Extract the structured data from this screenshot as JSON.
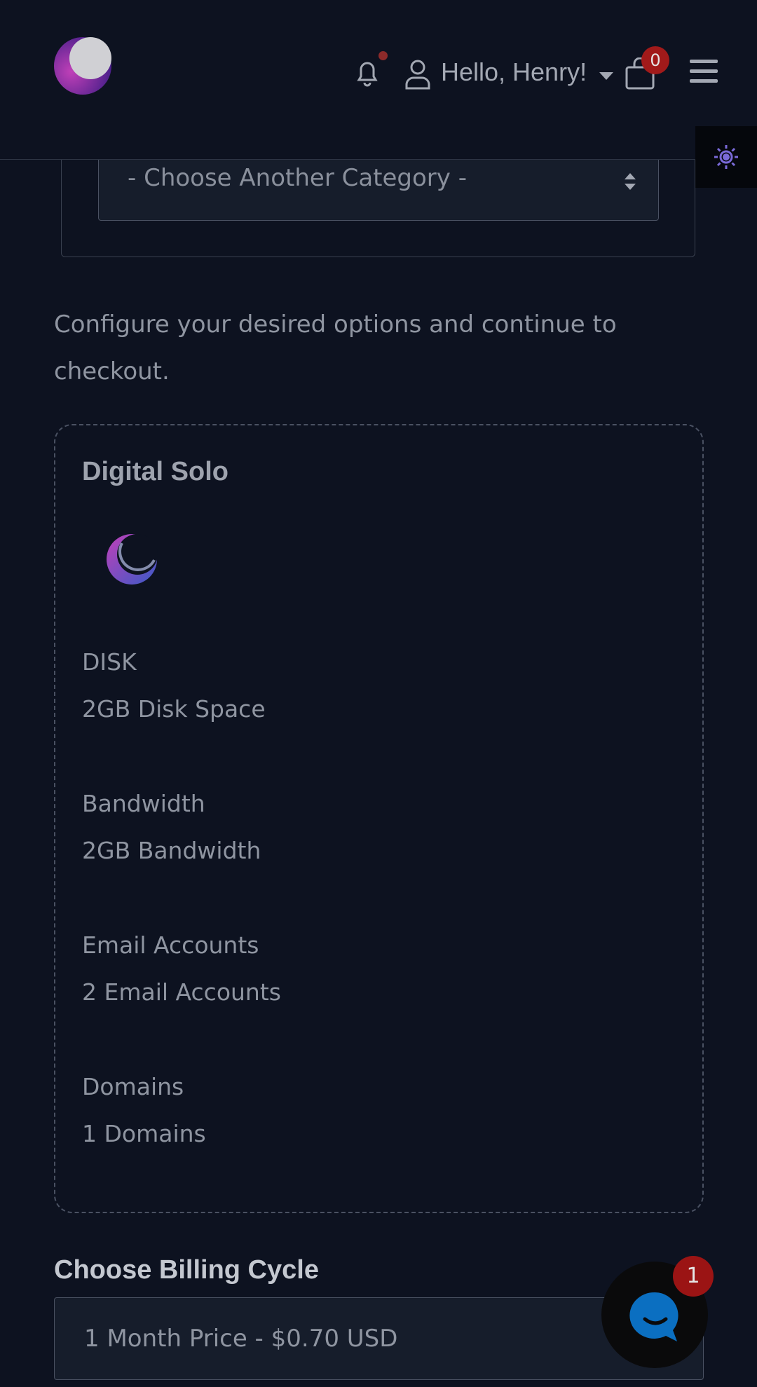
{
  "header": {
    "greeting": "Hello, Henry!",
    "cart_count": "0",
    "icons": [
      "logo",
      "bell-icon",
      "user-icon",
      "chevron-down-icon",
      "cart-icon",
      "hamburger-menu-icon"
    ]
  },
  "theme_toggle": {
    "icon": "sun-gear-icon",
    "color": "#7a6ad8"
  },
  "category_select": {
    "value": "- Choose Another Category -"
  },
  "intro_text": "Configure your desired options and continue to checkout.",
  "product": {
    "title": "Digital Solo",
    "features": [
      {
        "label": "DISK",
        "value": "2GB Disk Space"
      },
      {
        "label": "Bandwidth",
        "value": "2GB Bandwidth"
      },
      {
        "label": "Email Accounts",
        "value": "2 Email Accounts"
      },
      {
        "label": "Domains",
        "value": "1 Domains"
      }
    ]
  },
  "billing": {
    "title": "Choose Billing Cycle",
    "selected": "1 Month Price - $0.70 USD"
  },
  "chat": {
    "badge": "1",
    "accent": "#0b6fc1"
  }
}
